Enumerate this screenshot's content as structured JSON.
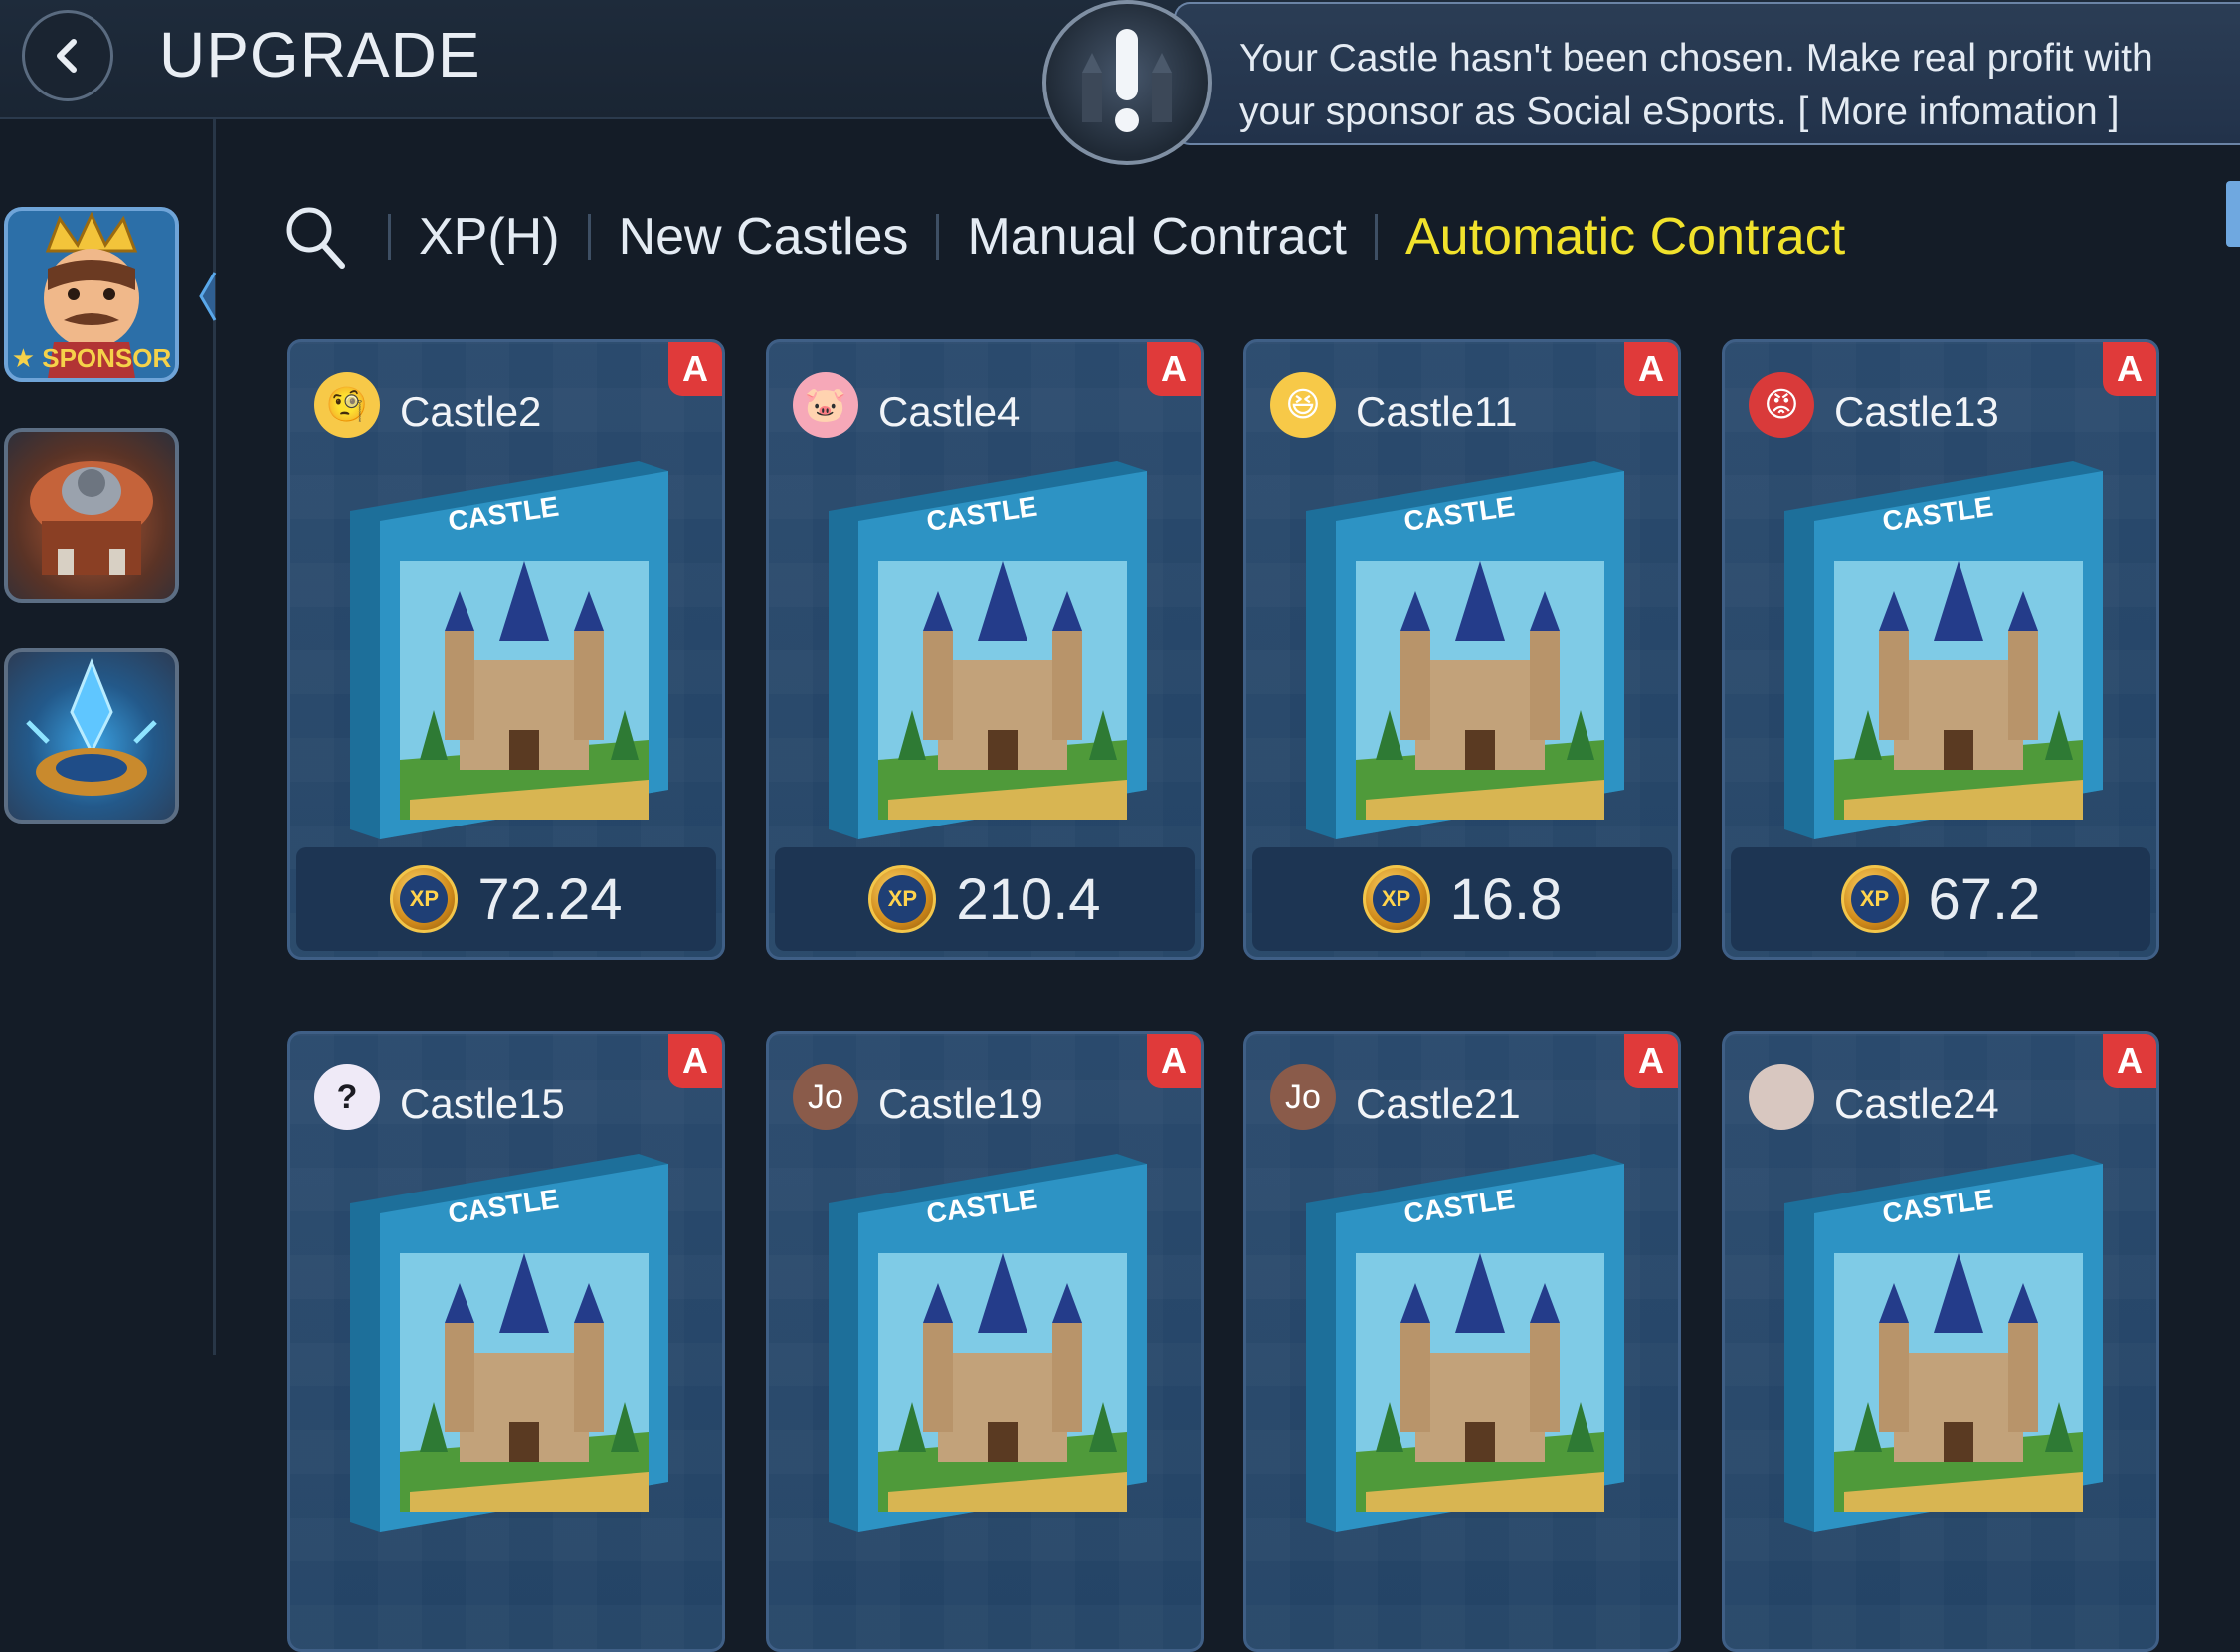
{
  "header": {
    "title": "UPGRADE",
    "back_icon": "chevron-left-icon",
    "notice": "Your Castle hasn't been chosen. Make real profit with your sponsor as Social eSports. [ More infomation ]"
  },
  "sidebar": {
    "items": [
      {
        "name": "sponsor",
        "label": "SPONSOR",
        "active": true
      },
      {
        "name": "tower",
        "label": "",
        "active": false
      },
      {
        "name": "crystal",
        "label": "",
        "active": false
      }
    ]
  },
  "filters": {
    "search_icon": "search-icon",
    "tabs": [
      {
        "label": "XP(H)",
        "active": false
      },
      {
        "label": "New Castles",
        "active": false
      },
      {
        "label": "Manual Contract",
        "active": false
      },
      {
        "label": "Automatic Contract",
        "active": true
      }
    ]
  },
  "cards": [
    {
      "name": "Castle2",
      "avatar": "monocle-emoji",
      "badge": "A",
      "box_title": "CASTLE",
      "price_icon": "XP",
      "price": "72.24"
    },
    {
      "name": "Castle4",
      "avatar": "pig-emoji",
      "badge": "A",
      "box_title": "CASTLE",
      "price_icon": "XP",
      "price": "210.4"
    },
    {
      "name": "Castle11",
      "avatar": "grin-emoji",
      "badge": "A",
      "box_title": "CASTLE",
      "price_icon": "XP",
      "price": "16.8"
    },
    {
      "name": "Castle13",
      "avatar": "angry-emoji",
      "badge": "A",
      "box_title": "CASTLE",
      "price_icon": "XP",
      "price": "67.2"
    },
    {
      "name": "Castle15",
      "avatar": "question-icon",
      "avatar_text": "?",
      "badge": "A",
      "box_title": "CASTLE"
    },
    {
      "name": "Castle19",
      "avatar": "initials",
      "avatar_text": "Jo",
      "badge": "A",
      "box_title": "CASTLE"
    },
    {
      "name": "Castle21",
      "avatar": "initials",
      "avatar_text": "Jo",
      "badge": "A",
      "box_title": "CASTLE"
    },
    {
      "name": "Castle24",
      "avatar": "photo",
      "badge": "A",
      "box_title": "CASTLE"
    }
  ],
  "colors": {
    "active_tab": "#f1e22c",
    "badge": "#e03a3a",
    "card_border": "#3f5f86"
  }
}
